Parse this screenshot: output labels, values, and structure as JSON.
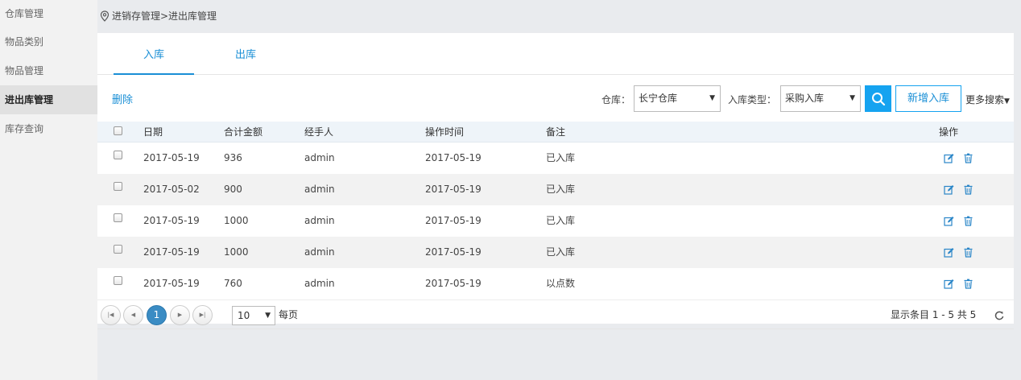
{
  "breadcrumb": "进销存管理>进出库管理",
  "sidebar": {
    "items": [
      {
        "label": "仓库管理"
      },
      {
        "label": "物品类别"
      },
      {
        "label": "物品管理"
      },
      {
        "label": "进出库管理",
        "active": true
      },
      {
        "label": "库存查询"
      }
    ]
  },
  "tabs": [
    {
      "label": "入库",
      "active": true
    },
    {
      "label": "出库",
      "active": false
    }
  ],
  "toolbar": {
    "delete_label": "删除",
    "warehouse_label": "仓库：",
    "warehouse_value": "长宁仓库",
    "type_label": "入库类型：",
    "type_value": "采购入库",
    "add_label": "新增入库",
    "more_label": "更多搜索"
  },
  "table": {
    "headers": {
      "date": "日期",
      "amount": "合计金额",
      "handler": "经手人",
      "time": "操作时间",
      "remark": "备注",
      "ops": "操作"
    },
    "rows": [
      {
        "date": "2017-05-19",
        "amount": "936",
        "handler": "admin",
        "time": "2017-05-19",
        "remark": "已入库"
      },
      {
        "date": "2017-05-02",
        "amount": "900",
        "handler": "admin",
        "time": "2017-05-19",
        "remark": "已入库"
      },
      {
        "date": "2017-05-19",
        "amount": "1000",
        "handler": "admin",
        "time": "2017-05-19",
        "remark": "已入库"
      },
      {
        "date": "2017-05-19",
        "amount": "1000",
        "handler": "admin",
        "time": "2017-05-19",
        "remark": "已入库"
      },
      {
        "date": "2017-05-19",
        "amount": "760",
        "handler": "admin",
        "time": "2017-05-19",
        "remark": "以点数"
      }
    ]
  },
  "pager": {
    "current_page": "1",
    "page_size": "10",
    "per_page_label": "每页",
    "summary": "显示条目 1 - 5 共 5"
  },
  "colors": {
    "accent": "#1a8fd6",
    "search_button": "#15a3f0",
    "current_page": "#3a8cc4"
  },
  "icons": [
    "location-icon",
    "search-icon",
    "edit-icon",
    "trash-icon",
    "first-page-icon",
    "prev-page-icon",
    "next-page-icon",
    "last-page-icon",
    "refresh-icon"
  ]
}
